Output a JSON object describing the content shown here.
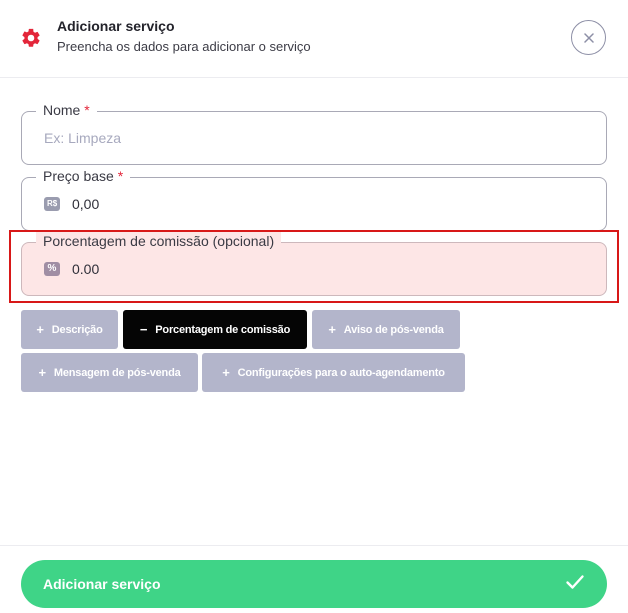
{
  "header": {
    "title": "Adicionar serviço",
    "subtitle": "Preencha os dados para adicionar o serviço",
    "icon": "gear-icon",
    "close_icon": "close-icon"
  },
  "form": {
    "name": {
      "label": "Nome",
      "required_mark": "*",
      "placeholder": "Ex: Limpeza"
    },
    "price": {
      "label": "Preço base",
      "required_mark": "*",
      "badge": "R$",
      "value": "0,00"
    },
    "commission": {
      "label": "Porcentagem de comissão (opcional)",
      "badge": "%",
      "value": "0.00"
    }
  },
  "options": [
    {
      "label": "Descrição",
      "icon": "+",
      "active": false
    },
    {
      "label": "Porcentagem de comissão",
      "icon": "−",
      "active": true
    },
    {
      "label": "Aviso de pós-venda",
      "icon": "+",
      "active": false
    },
    {
      "label": "Mensagem de pós-venda",
      "icon": "+",
      "active": false
    },
    {
      "label": "Configurações para o auto-agendamento",
      "icon": "+",
      "active": false
    }
  ],
  "footer": {
    "submit_label": "Adicionar serviço",
    "submit_icon": "check-icon"
  },
  "colors": {
    "accent_red": "#e3263a",
    "submit_green": "#3fd487",
    "chip_inactive": "#b3b5cb",
    "chip_active": "#050505",
    "highlight": "#d81818"
  }
}
